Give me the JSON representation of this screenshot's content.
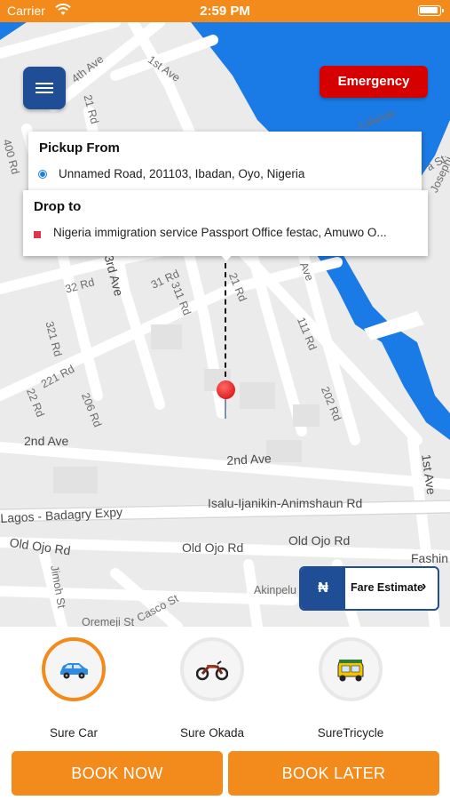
{
  "status_bar": {
    "carrier": "Carrier",
    "time": "2:59 PM"
  },
  "header": {
    "emergency_label": "Emergency"
  },
  "pickup": {
    "title": "Pickup From",
    "address": "Unnamed Road, 201103, Ibadan, Oyo, Nigeria"
  },
  "drop": {
    "title": "Drop to",
    "address": "Nigeria immigration service Passport Office festac, Amuwo O..."
  },
  "map": {
    "labels": [
      "4th Ave",
      "1st Ave",
      "21 Rd",
      "400 Rd",
      "3rd Ave",
      "32 Rd",
      "31 Rd",
      "311 Rd",
      "21 Rd",
      "111 Rd",
      "321 Rd",
      "221 Rd",
      "22 Rd",
      "206 Rd",
      "202 Rd",
      "2nd Ave",
      "2nd Ave",
      "1st Ave",
      "Lagos - Badagry Expy",
      "Isalu-Ijanikin-Animshaun Rd",
      "Old Ojo Rd",
      "Old Ojo Rd",
      "Old Ojo Rd",
      "Jimoh St",
      "Oremeji St",
      "Casco St",
      "Akinpelu St",
      "Fashin",
      "Lakevie",
      "Josephi",
      "a St",
      "Ave"
    ]
  },
  "fare": {
    "currency_symbol": "₦",
    "label": "Fare Estimate"
  },
  "vehicles": [
    {
      "label": "Sure Car",
      "icon": "car-icon",
      "selected": true
    },
    {
      "label": "Sure Okada",
      "icon": "motorcycle-icon",
      "selected": false
    },
    {
      "label": "SureTricycle",
      "icon": "tricycle-icon",
      "selected": false
    }
  ],
  "actions": {
    "book_now": "BOOK NOW",
    "book_later": "BOOK LATER"
  },
  "colors": {
    "accent": "#f28b1c",
    "brand_blue": "#1f4e96",
    "emergency": "#d60000",
    "water": "#1a7be6"
  }
}
